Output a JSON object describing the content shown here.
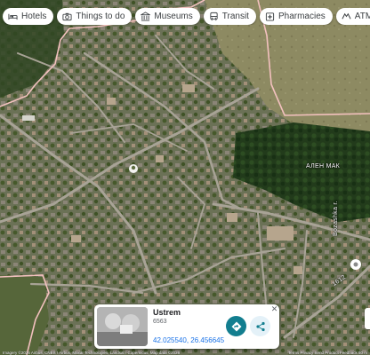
{
  "categories": [
    {
      "label": "Hotels",
      "icon": "bed-icon"
    },
    {
      "label": "Things to do",
      "icon": "camera-icon"
    },
    {
      "label": "Museums",
      "icon": "museum-icon"
    },
    {
      "label": "Transit",
      "icon": "bus-icon"
    },
    {
      "label": "Pharmacies",
      "icon": "pharmacy-icon"
    },
    {
      "label": "ATMs",
      "icon": "atm-icon"
    }
  ],
  "map": {
    "labels": {
      "area": "АЛЕН МАК",
      "street_vertical": "Bozashka r.",
      "road_number": "1612"
    },
    "colors": {
      "boundary": "#f3c1bf",
      "road": "#a8a396",
      "forest": "#1f3a1a",
      "meadow": "#8e8a64",
      "town": "#6b7156"
    }
  },
  "place_card": {
    "title": "Ustrem",
    "subtitle": "6563",
    "coordinates": "42.025540, 26.456645",
    "close_symbol": "✕",
    "directions_color": "#137e8f",
    "share_color": "#e4f1f8"
  },
  "footer": {
    "attribution": "Imagery ©2026 Airbus, CNES / Airbus, Maxar Technologies, Landsat / Copernicus, Map data ©2026",
    "scale": "Terms  Privacy  Send Product Feedback  50 m"
  }
}
